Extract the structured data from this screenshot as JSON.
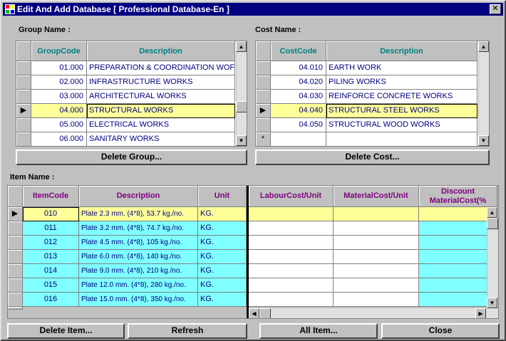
{
  "window": {
    "title": "Edit And Add Database [ Professional Database-En ]",
    "close_glyph": "✕"
  },
  "group": {
    "label": "Group Name :",
    "headers": [
      "GroupCode",
      "Description"
    ],
    "rows": [
      {
        "code": "01.000",
        "desc": "PREPARATION & COORDINATION WOF"
      },
      {
        "code": "02.000",
        "desc": "INFRASTRUCTURE WORKS"
      },
      {
        "code": "03.000",
        "desc": "ARCHITECTURAL WORKS"
      },
      {
        "code": "04.000",
        "desc": "STRUCTURAL WORKS"
      },
      {
        "code": "05.000",
        "desc": "ELECTRICAL WORKS"
      },
      {
        "code": "06.000",
        "desc": "SANITARY WORKS"
      }
    ],
    "selected_index": 3
  },
  "cost": {
    "label": "Cost Name :",
    "headers": [
      "CostCode",
      "Description"
    ],
    "rows": [
      {
        "code": "04.010",
        "desc": "EARTH WORK"
      },
      {
        "code": "04.020",
        "desc": "PILING WORKS"
      },
      {
        "code": "04.030",
        "desc": "REINFORCE CONCRETE WORKS"
      },
      {
        "code": "04.040",
        "desc": "STRUCTURAL STEEL WORKS"
      },
      {
        "code": "04.050",
        "desc": "STRUCTURAL WOOD WORKS"
      }
    ],
    "selected_index": 3,
    "new_row_glyph": "*"
  },
  "item": {
    "label": "Item Name :",
    "headers": [
      "ItemCode",
      "Description",
      "Unit",
      "LabourCost/Unit",
      "MaterialCost/Unit",
      "Discount MaterialCost(%"
    ],
    "rows": [
      {
        "code": "010",
        "desc": "Plate 2.3  mm. (4*8), 53.7 kg./no.",
        "unit": "KG."
      },
      {
        "code": "011",
        "desc": "Plate 3.2  mm. (4*8), 74.7 kg./no.",
        "unit": "KG."
      },
      {
        "code": "012",
        "desc": "Plate 4.5  mm. (4*8), 105 kg./no.",
        "unit": "KG."
      },
      {
        "code": "013",
        "desc": "Plate 6.0  mm. (4*8), 140 kg./no.",
        "unit": "KG."
      },
      {
        "code": "014",
        "desc": "Plate 9.0  mm. (4*8), 210 kg./no.",
        "unit": "KG."
      },
      {
        "code": "015",
        "desc": "Plate 12.0  mm. (4*8), 280 kg./no.",
        "unit": "KG."
      },
      {
        "code": "016",
        "desc": "Plate 15.0  mm. (4*8), 350 kg./no.",
        "unit": "KG."
      }
    ],
    "selected_index": 0
  },
  "buttons": {
    "delete_group": "Delete Group...",
    "delete_cost": "Delete Cost...",
    "delete_item": "Delete Item...",
    "refresh": "Refresh",
    "all_item": "All Item...",
    "close": "Close"
  },
  "glyphs": {
    "row_pointer": "▶",
    "up": "▲",
    "down": "▼",
    "left": "◀",
    "right": "▶"
  }
}
